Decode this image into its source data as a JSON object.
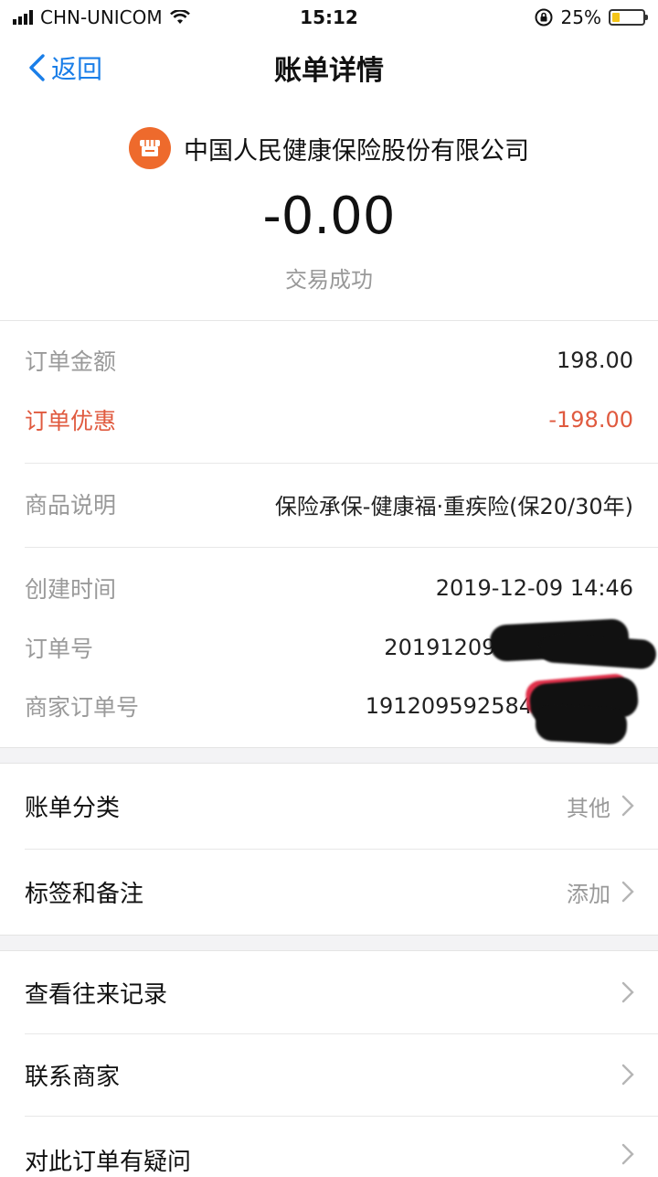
{
  "status_bar": {
    "carrier": "CHN-UNICOM",
    "time": "15:12",
    "battery": "25%",
    "battery_level": 0.25
  },
  "nav": {
    "back_label": "返回",
    "title": "账单详情"
  },
  "header": {
    "merchant": "中国人民健康保险股份有限公司",
    "amount": "-0.00",
    "status": "交易成功"
  },
  "details": {
    "order_amount": {
      "label": "订单金额",
      "value": "198.00"
    },
    "order_discount": {
      "label": "订单优惠",
      "value": "-198.00"
    },
    "product_desc": {
      "label": "商品说明",
      "value": "保险承保-健康福·重疾险(保20/30年)"
    },
    "created_time": {
      "label": "创建时间",
      "value": "2019-12-09 14:46"
    },
    "order_no": {
      "label": "订单号",
      "value": "2019120904"
    },
    "merchant_order_no": {
      "label": "商家订单号",
      "value": "191209592584"
    }
  },
  "menu": {
    "category": {
      "label": "账单分类",
      "value": "其他"
    },
    "tags": {
      "label": "标签和备注",
      "value": "添加"
    },
    "history": {
      "label": "查看往来记录"
    },
    "contact": {
      "label": "联系商家"
    },
    "question": {
      "label": "对此订单有疑问"
    }
  },
  "colors": {
    "accent": "#1a7ee8",
    "discount": "#e05a3f",
    "merchant_logo": "#ee6a2c"
  }
}
